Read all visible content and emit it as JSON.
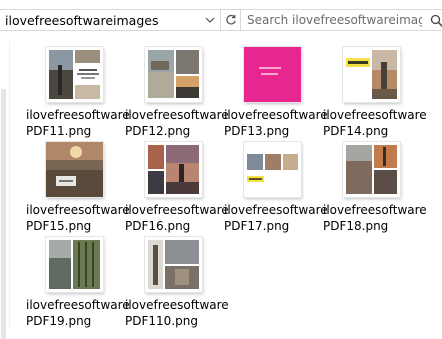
{
  "address_bar": {
    "path": "ilovefreesoftwareimages"
  },
  "search": {
    "placeholder": "Search ilovefreesoftwareimages"
  },
  "files": [
    {
      "line1": "ilovefreesoftware",
      "line2": "PDF11.png"
    },
    {
      "line1": "ilovefreesoftware",
      "line2": "PDF12.png"
    },
    {
      "line1": "ilovefreesoftware",
      "line2": "PDF13.png"
    },
    {
      "line1": "ilovefreesoftware",
      "line2": "PDF14.png"
    },
    {
      "line1": "ilovefreesoftware",
      "line2": "PDF15.png"
    },
    {
      "line1": "ilovefreesoftware",
      "line2": "PDF16.png"
    },
    {
      "line1": "ilovefreesoftware",
      "line2": "PDF17.png"
    },
    {
      "line1": "ilovefreesoftware",
      "line2": "PDF18.png"
    },
    {
      "line1": "ilovefreesoftware",
      "line2": "PDF19.png"
    },
    {
      "line1": "ilovefreesoftware",
      "line2": "PDF110.png"
    }
  ],
  "icons": {
    "dropdown": "chevron-down-icon",
    "refresh": "refresh-icon",
    "search": "search-icon"
  },
  "colors": {
    "pink_cover": "#e8268f",
    "yellow_label": "#f5e04a"
  }
}
